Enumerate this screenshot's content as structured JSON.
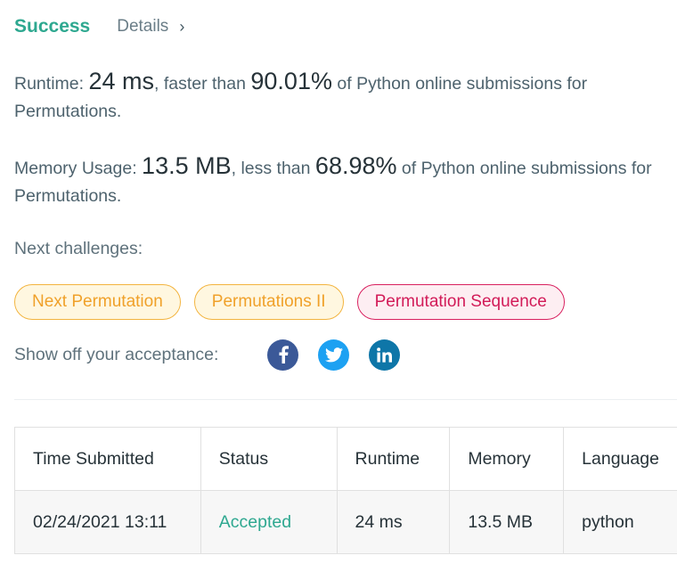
{
  "header": {
    "status": "Success",
    "details_label": "Details",
    "chevron": "›"
  },
  "runtime": {
    "label": "Runtime:",
    "value": "24 ms",
    "comparison": ", faster than ",
    "percent": "90.01%",
    "suffix": " of Python online submissions for Permutations."
  },
  "memory": {
    "label": "Memory Usage:",
    "value": "13.5 MB",
    "comparison": ", less than ",
    "percent": "68.98%",
    "suffix": " of Python online submissions for Permutations."
  },
  "next_challenges": {
    "label": "Next challenges:",
    "items": [
      {
        "label": "Next Permutation",
        "difficulty": "medium"
      },
      {
        "label": "Permutations II",
        "difficulty": "medium"
      },
      {
        "label": "Permutation Sequence",
        "difficulty": "hard"
      }
    ]
  },
  "share": {
    "label": "Show off your acceptance:",
    "icons": [
      "facebook-icon",
      "twitter-icon",
      "linkedin-icon"
    ]
  },
  "table": {
    "headers": [
      "Time Submitted",
      "Status",
      "Runtime",
      "Memory",
      "Language"
    ],
    "rows": [
      [
        "02/24/2021 13:11",
        "Accepted",
        "24 ms",
        "13.5 MB",
        "python"
      ]
    ]
  },
  "colors": {
    "success": "#2ea890",
    "medium": "#f0a12a",
    "hard": "#d21b58",
    "facebook": "#3b5998",
    "twitter": "#1da1f2",
    "linkedin": "#0e76a8"
  }
}
